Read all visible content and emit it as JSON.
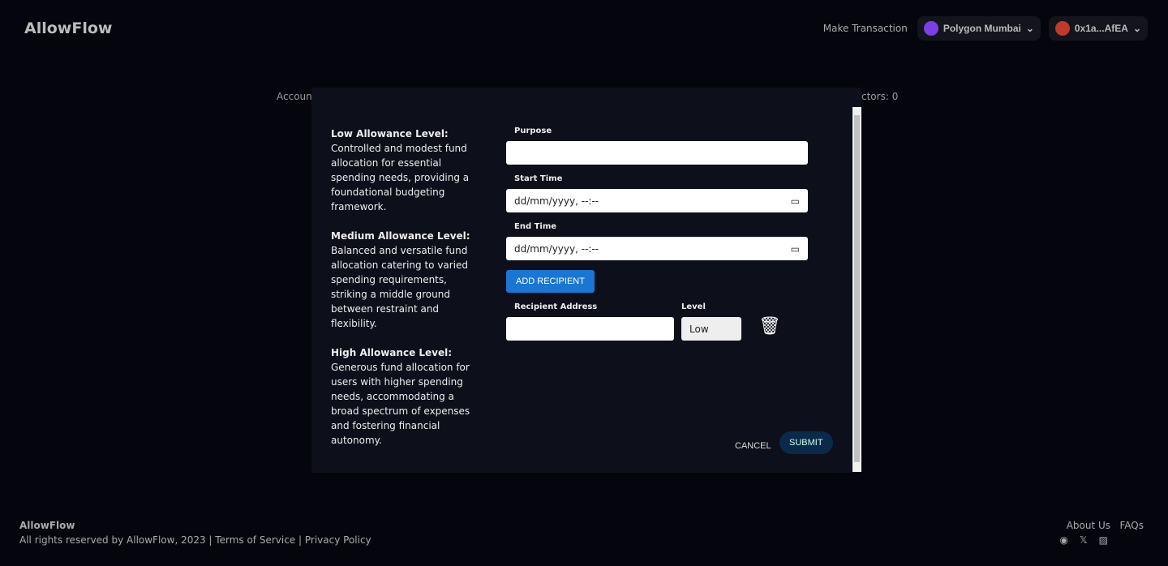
{
  "header": {
    "logo": "AllowFlow",
    "make_transaction": "Make Transaction",
    "network": "Polygon Mumbai",
    "account": "0x1a...AfEA"
  },
  "background": {
    "left_text": "Account",
    "right_text": "ctors:  0"
  },
  "modal": {
    "descriptions": [
      {
        "title": "Low Allowance Level:",
        "text": " Controlled and modest fund allocation for essential spending needs, providing a foundational budgeting framework."
      },
      {
        "title": "Medium Allowance Level:",
        "text": " Balanced and versatile fund allocation catering to varied spending requirements, striking a middle ground between restraint and flexibility."
      },
      {
        "title": "High Allowance Level:",
        "text": " Generous fund allocation for users with higher spending needs, accommodating a broad spectrum of expenses and fostering financial autonomy."
      }
    ],
    "purpose_label": "Purpose",
    "purpose_value": "",
    "start_label": "Start Time",
    "start_value": "dd/mm/yyyy, --:--",
    "end_label": "End Time",
    "end_value": "dd/mm/yyyy, --:--",
    "add_recipient": "ADD RECIPIENT",
    "recipient_label": "Recipient Address",
    "level_label": "Level",
    "level_value": "Low",
    "cancel": "CANCEL",
    "submit": "SUBMIT"
  },
  "footer": {
    "brand": "AllowFlow",
    "rights": "All rights reserved by AllowFlow, 2023 | ",
    "terms": "Terms of Service",
    "sep": " | ",
    "privacy": "Privacy Policy",
    "about": "About Us",
    "faqs": "FAQs"
  }
}
